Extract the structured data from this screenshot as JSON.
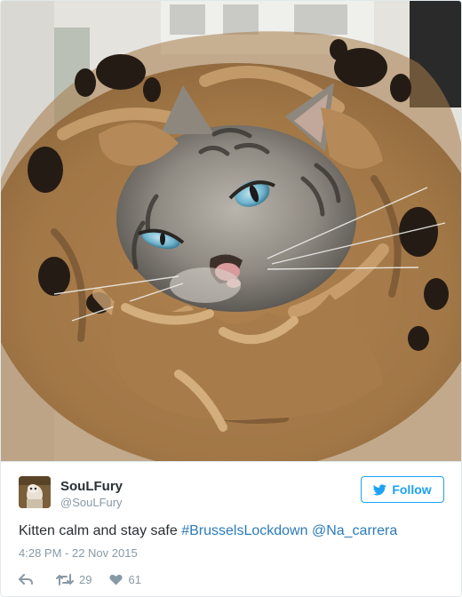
{
  "user": {
    "display_name": "SouLFury",
    "screen_name": "@SouLFury"
  },
  "follow_button": {
    "label": "Follow",
    "icon": "twitter-bird-icon",
    "color": "#1da1f2"
  },
  "tweet": {
    "text": "Kitten calm and stay safe ",
    "hashtag": "#BrusselsLockdown",
    "mention": "@Na_carrera",
    "timestamp": "4:28 PM - 22 Nov 2015",
    "link_color": "#2b7bb9"
  },
  "actions": {
    "reply_icon": "reply-icon",
    "retweet_icon": "retweet-icon",
    "retweet_count": "29",
    "like_icon": "heart-icon",
    "like_count": "61"
  },
  "media": {
    "subject_icon": "kitten-photo"
  }
}
